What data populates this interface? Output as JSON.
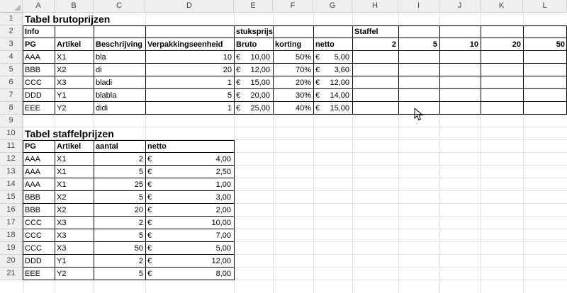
{
  "columns": [
    "A",
    "B",
    "C",
    "D",
    "E",
    "F",
    "G",
    "H",
    "I",
    "J",
    "K",
    "L"
  ],
  "rows": [
    "1",
    "2",
    "3",
    "4",
    "5",
    "6",
    "7",
    "8",
    "9",
    "10",
    "11",
    "12",
    "13",
    "14",
    "15",
    "16",
    "17",
    "18",
    "19",
    "20",
    "21"
  ],
  "table1": {
    "title": "Tabel brutoprijzen",
    "row2": {
      "info": "Info",
      "stuksprijs": "stuksprijs",
      "staffel": "Staffel"
    },
    "headers": {
      "pg": "PG",
      "artikel": "Artikel",
      "beschrijving": "Beschrijving",
      "verpakking": "Verpakkingseenheid",
      "bruto": "Bruto",
      "korting": "korting",
      "netto": "netto",
      "s2": "2",
      "s5": "5",
      "s10": "10",
      "s20": "20",
      "s50": "50"
    },
    "rows": [
      {
        "pg": "AAA",
        "artikel": "X1",
        "beschrijving": "bla",
        "verpakking": "10",
        "bruto_sym": "€",
        "bruto": "10,00",
        "korting": "50%",
        "netto_sym": "€",
        "netto": "5,00"
      },
      {
        "pg": "BBB",
        "artikel": "X2",
        "beschrijving": "di",
        "verpakking": "20",
        "bruto_sym": "€",
        "bruto": "12,00",
        "korting": "70%",
        "netto_sym": "€",
        "netto": "3,60"
      },
      {
        "pg": "CCC",
        "artikel": "X3",
        "beschrijving": "bladi",
        "verpakking": "1",
        "bruto_sym": "€",
        "bruto": "15,00",
        "korting": "20%",
        "netto_sym": "€",
        "netto": "12,00"
      },
      {
        "pg": "DDD",
        "artikel": "Y1",
        "beschrijving": "blabla",
        "verpakking": "5",
        "bruto_sym": "€",
        "bruto": "20,00",
        "korting": "30%",
        "netto_sym": "€",
        "netto": "14,00"
      },
      {
        "pg": "EEE",
        "artikel": "Y2",
        "beschrijving": "didi",
        "verpakking": "1",
        "bruto_sym": "€",
        "bruto": "25,00",
        "korting": "40%",
        "netto_sym": "€",
        "netto": "15,00"
      }
    ]
  },
  "table2": {
    "title": "Tabel staffelprijzen",
    "headers": {
      "pg": "PG",
      "artikel": "Artikel",
      "aantal": "aantal",
      "netto": "netto"
    },
    "rows": [
      {
        "pg": "AAA",
        "artikel": "X1",
        "aantal": "2",
        "netto_sym": "€",
        "netto": "4,00"
      },
      {
        "pg": "AAA",
        "artikel": "X1",
        "aantal": "5",
        "netto_sym": "€",
        "netto": "2,50"
      },
      {
        "pg": "AAA",
        "artikel": "X1",
        "aantal": "25",
        "netto_sym": "€",
        "netto": "1,00"
      },
      {
        "pg": "BBB",
        "artikel": "X2",
        "aantal": "5",
        "netto_sym": "€",
        "netto": "3,00"
      },
      {
        "pg": "BBB",
        "artikel": "X2",
        "aantal": "20",
        "netto_sym": "€",
        "netto": "2,00"
      },
      {
        "pg": "CCC",
        "artikel": "X3",
        "aantal": "2",
        "netto_sym": "€",
        "netto": "10,00"
      },
      {
        "pg": "CCC",
        "artikel": "X3",
        "aantal": "5",
        "netto_sym": "€",
        "netto": "7,00"
      },
      {
        "pg": "CCC",
        "artikel": "X3",
        "aantal": "50",
        "netto_sym": "€",
        "netto": "5,00"
      },
      {
        "pg": "DDD",
        "artikel": "Y1",
        "aantal": "2",
        "netto_sym": "€",
        "netto": "12,00"
      },
      {
        "pg": "EEE",
        "artikel": "Y2",
        "aantal": "5",
        "netto_sym": "€",
        "netto": "8,00"
      }
    ]
  },
  "icons": {
    "cursor": "mouse-pointer-icon",
    "select_all": "select-all-triangle-icon"
  }
}
